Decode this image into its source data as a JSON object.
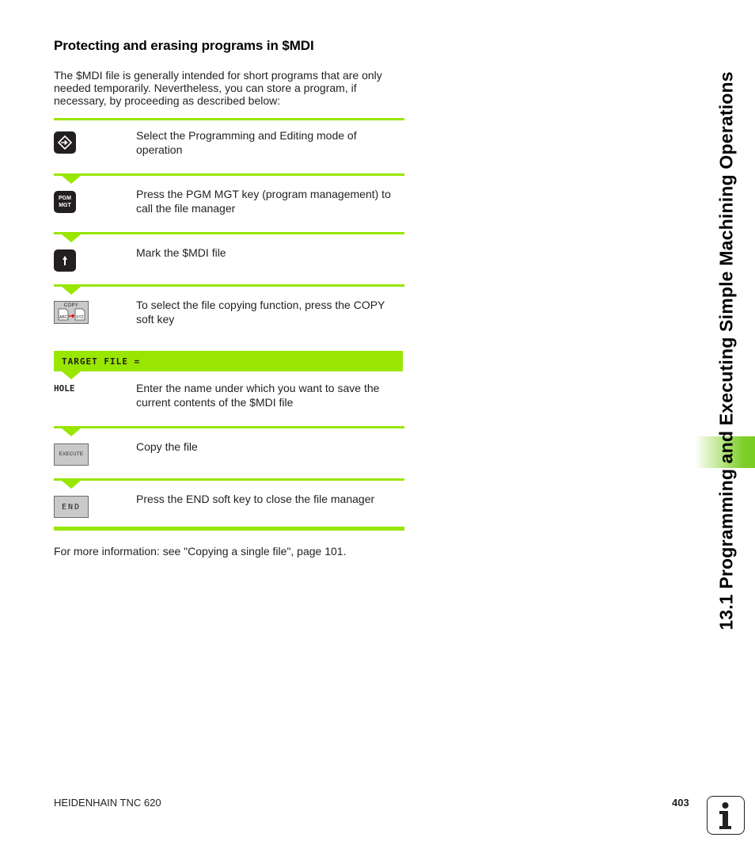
{
  "section": {
    "heading": "Protecting and erasing programs in $MDI",
    "intro": "The $MDI file is generally intended for short programs that are only needed temporarily. Nevertheless, you can store a program, if necessary, by proceeding as described below:"
  },
  "steps": [
    {
      "key_type": "dark-key",
      "icon": "programming-editing-mode-icon",
      "text": "Select the Programming and Editing mode of operation"
    },
    {
      "key_type": "dark-key",
      "key_label_line1": "PGM",
      "key_label_line2": "MGT",
      "text": "Press the PGM MGT key (program management) to call the file manager"
    },
    {
      "key_type": "dark-key",
      "icon": "arrow-up-icon",
      "text": "Mark the $MDI file"
    },
    {
      "key_type": "soft-key",
      "key_label": "COPY",
      "from_label": "ABC",
      "to_label": "XYZ",
      "text": "To select the file copying function, press the COPY soft key"
    },
    {
      "key_type": "input",
      "prompt": "TARGET FILE =",
      "value": "HOLE",
      "text": "Enter the name under which you want to save the current contents of the $MDI file"
    },
    {
      "key_type": "soft-key",
      "key_label": "EXECUTE",
      "text": "Copy the file"
    },
    {
      "key_type": "soft-key",
      "key_label": "END",
      "text": "Press the END soft key to close the file manager"
    }
  ],
  "more_info": "For more information: see \"Copying a single file\", page 101.",
  "side_title": "13.1 Programming and Executing Simple Machining Operations",
  "footer": {
    "product": "HEIDENHAIN TNC 620",
    "page_number": "403",
    "info_icon_glyph": "i"
  },
  "colors": {
    "accent_green": "#99e600",
    "key_dark": "#231f20",
    "softkey_gray": "#c9c9c9"
  }
}
